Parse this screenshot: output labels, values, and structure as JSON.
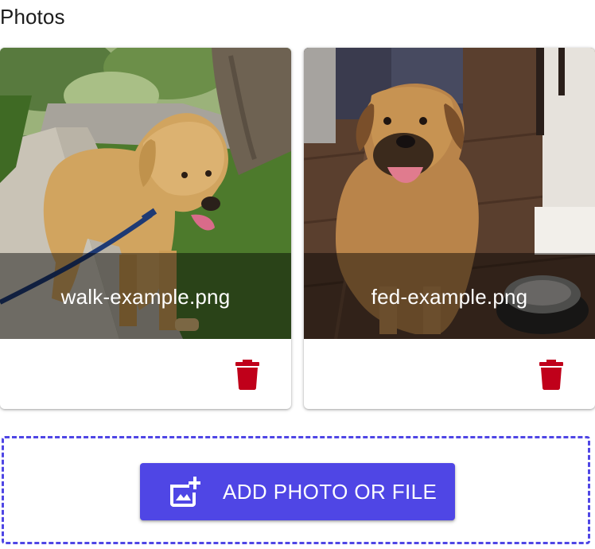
{
  "section": {
    "title": "Photos"
  },
  "photos": [
    {
      "caption": "walk-example.png",
      "image_icon": "photo-golden-retriever-walk",
      "delete_icon": "trash-icon"
    },
    {
      "caption": "fed-example.png",
      "image_icon": "photo-dog-by-bowl",
      "delete_icon": "trash-icon"
    }
  ],
  "upload": {
    "button_label": "ADD PHOTO OR FILE",
    "button_icon": "add-photo-icon"
  },
  "colors": {
    "accent": "#4f46e5",
    "delete": "#c0001a",
    "caption_overlay": "rgba(0,0,0,0.45)"
  }
}
